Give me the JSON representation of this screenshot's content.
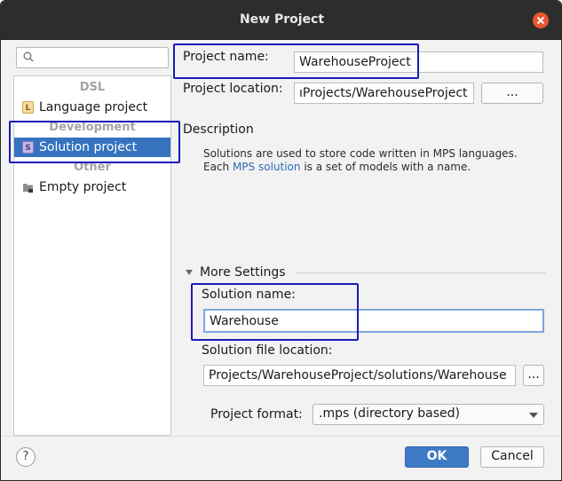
{
  "window": {
    "title": "New Project"
  },
  "search": {
    "placeholder": ""
  },
  "project_types": {
    "groups": [
      {
        "label": "DSL",
        "items": [
          {
            "label": "Language project",
            "icon": "language-project-icon"
          }
        ]
      },
      {
        "label": "Development",
        "items": [
          {
            "label": "Solution project",
            "icon": "solution-project-icon",
            "selected": true
          }
        ]
      },
      {
        "label": "Other",
        "items": [
          {
            "label": "Empty project",
            "icon": "empty-project-icon"
          }
        ]
      }
    ]
  },
  "form": {
    "project_name_label": "Project name:",
    "project_name_value": "WarehouseProject",
    "project_location_label": "Project location:",
    "project_location_value": "ıProjects/WarehouseProject",
    "browse_label": "...",
    "description_header": "Description",
    "description_line1": "Solutions are used to store code written in MPS languages.",
    "description_line2_pre": "Each ",
    "description_link": "MPS solution",
    "description_line2_post": " is a set of models with a name.",
    "more_settings_label": "More Settings",
    "solution_name_label": "Solution name:",
    "solution_name_value": "Warehouse",
    "solution_file_location_label": "Solution file location:",
    "solution_file_location_value": "Projects/WarehouseProject/solutions/Warehouse",
    "solution_browse_label": "...",
    "project_format_label": "Project format:",
    "project_format_value": ".mps (directory based)"
  },
  "footer": {
    "help_label": "?",
    "ok_label": "OK",
    "cancel_label": "Cancel"
  },
  "colors": {
    "selection": "#3573bf",
    "highlight_box": "#1a1ab8",
    "link": "#2e6ab6",
    "primary_button": "#3f7ac6"
  }
}
